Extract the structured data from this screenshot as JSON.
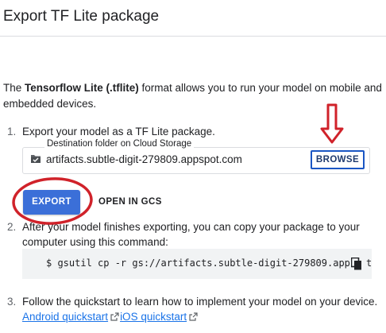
{
  "dialog": {
    "title": "Export TF Lite package"
  },
  "intro": {
    "prefix": "The ",
    "format_name": "Tensorflow Lite (.tflite)",
    "suffix": " format allows you to run your model on mobile and embedded devices."
  },
  "steps": [
    {
      "number": "1.",
      "text": "Export your model as a TF Lite package."
    },
    {
      "number": "2.",
      "text_line1": "After your model finishes exporting, you can copy your package to your",
      "text_line2": "computer using this command:"
    },
    {
      "number": "3.",
      "text": "Follow the quickstart to learn how to implement your model on your device."
    }
  ],
  "destination": {
    "label": "Destination folder on Cloud Storage",
    "value": "artifacts.subtle-digit-279809.appspot.com",
    "icon": "folder-icon",
    "browse_label": "BROWSE"
  },
  "actions": {
    "export_label": "EXPORT",
    "open_gcs_label": "OPEN IN GCS"
  },
  "command": {
    "text": "$ gsutil cp -r gs://artifacts.subtle-digit-279809.app",
    "tail": "t",
    "copy_icon": "copy-icon"
  },
  "links": {
    "android": "Android quickstart",
    "ios": "iOS quickstart",
    "external_icon": "external-link-icon"
  },
  "annotations": {
    "color": "#d0222a"
  },
  "colors": {
    "primary": "#3b6fd8",
    "link": "#1a73e8",
    "code_bg": "#f1f3f4"
  }
}
